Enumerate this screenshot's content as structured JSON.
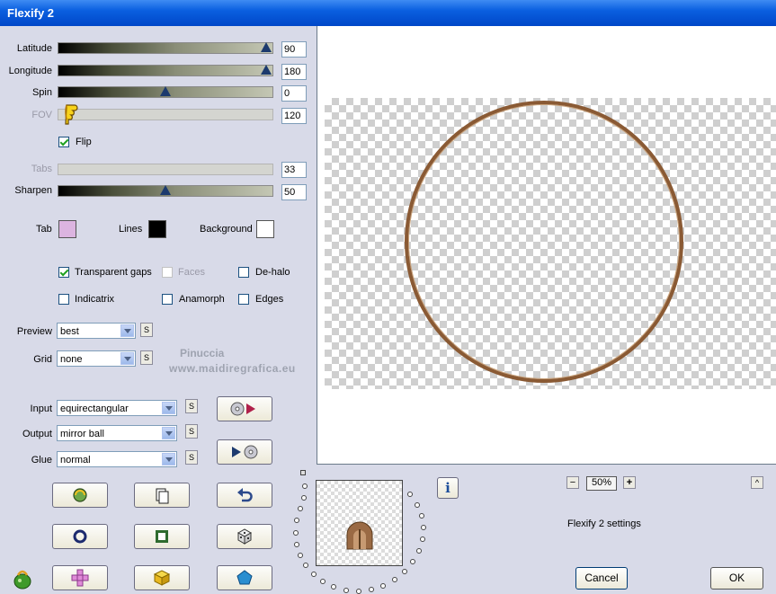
{
  "window": {
    "title": "Flexify 2"
  },
  "sliders": [
    {
      "label": "Latitude",
      "value": "90",
      "enabled": true,
      "position": 0.97
    },
    {
      "label": "Longitude",
      "value": "180",
      "enabled": true,
      "position": 0.97
    },
    {
      "label": "Spin",
      "value": "0",
      "enabled": true,
      "position": 0.5
    },
    {
      "label": "FOV",
      "value": "120",
      "enabled": false,
      "position": 0.0
    },
    {
      "label": "Tabs",
      "value": "33",
      "enabled": false,
      "position": 0.0
    },
    {
      "label": "Sharpen",
      "value": "50",
      "enabled": true,
      "position": 0.5
    }
  ],
  "flip": {
    "label": "Flip",
    "checked": true
  },
  "colors": {
    "tab": {
      "label": "Tab",
      "color": "#dcb4e0"
    },
    "lines": {
      "label": "Lines",
      "color": "#000000"
    },
    "background": {
      "label": "Background",
      "color": "#ffffff"
    }
  },
  "options": {
    "transparent_gaps": {
      "label": "Transparent gaps",
      "checked": true
    },
    "faces": {
      "label": "Faces",
      "checked": false,
      "enabled": false
    },
    "de_halo": {
      "label": "De-halo",
      "checked": false
    },
    "indicatrix": {
      "label": "Indicatrix",
      "checked": false
    },
    "anamorph": {
      "label": "Anamorph",
      "checked": false
    },
    "edges": {
      "label": "Edges",
      "checked": false
    }
  },
  "preview": {
    "label": "Preview",
    "value": "best"
  },
  "grid": {
    "label": "Grid",
    "value": "none"
  },
  "input": {
    "label": "Input",
    "value": "equirectangular"
  },
  "output": {
    "label": "Output",
    "value": "mirror ball"
  },
  "glue": {
    "label": "Glue",
    "value": "normal"
  },
  "s_label": "S",
  "watermark": {
    "line1": "Pinuccia",
    "line2": "www.maidiregrafica.eu"
  },
  "zoom": {
    "value": "50%",
    "minus": "−",
    "plus": "+"
  },
  "settings_name": "Flexify 2 settings",
  "collapse_label": "^",
  "info_label": "i",
  "buttons": {
    "cancel": "Cancel",
    "ok": "OK"
  },
  "icons": {
    "input_play": "cd-to-play-icon",
    "output_play": "play-to-cd-icon",
    "random": "randomize-icon",
    "copy": "copy-icon",
    "undo": "undo-icon",
    "circle": "circle-icon",
    "square": "square-icon",
    "dice": "dice-icon",
    "cube_net": "cube-net-icon",
    "cube": "cube-icon",
    "pentagon": "pentagon-icon",
    "flexify_logo": "flexify-logo-icon"
  }
}
